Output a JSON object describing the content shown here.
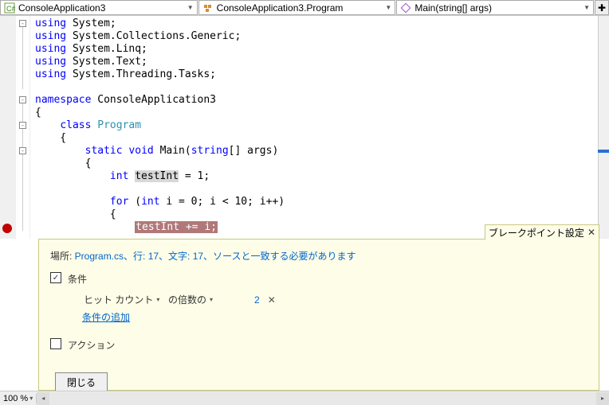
{
  "nav": {
    "scope": "ConsoleApplication3",
    "class": "ConsoleApplication3.Program",
    "member": "Main(string[] args)"
  },
  "code": {
    "l1_kw": "using",
    "l1_ns": "System;",
    "l2_kw": "using",
    "l2_ns": "System.Collections.Generic;",
    "l3_kw": "using",
    "l3_ns": "System.Linq;",
    "l4_kw": "using",
    "l4_ns": "System.Text;",
    "l5_kw": "using",
    "l5_ns": "System.Threading.Tasks;",
    "l7_kw": "namespace",
    "l7_ns": "ConsoleApplication3",
    "l8": "{",
    "l9_kw": "class",
    "l9_ty": "Program",
    "l10": "    {",
    "l11_kw1": "static",
    "l11_kw2": "void",
    "l11_name": "Main(",
    "l11_kw3": "string",
    "l11_rest": "[] args)",
    "l12": "        {",
    "l13_kw": "int",
    "l13_var": "testInt",
    "l13_rest": " = 1;",
    "l15_kw1": "for",
    "l15_p1": " (",
    "l15_kw2": "int",
    "l15_rest": " i = 0; i < 10; i++)",
    "l16": "            {",
    "l17_var": "testInt",
    "l17_op": " += i;"
  },
  "bp": {
    "title": "ブレークポイント設定",
    "loc_label": "場所: ",
    "loc_link": "Program.cs、行: 17、文字: 17、ソースと一致する必要があります",
    "cond_label": "条件",
    "hit_label": "ヒット カウント",
    "mult_label": "の倍数の",
    "value": "2",
    "add_cond": "条件の追加",
    "action_label": "アクション",
    "close_btn": "閉じる"
  },
  "zoom": "100 %"
}
